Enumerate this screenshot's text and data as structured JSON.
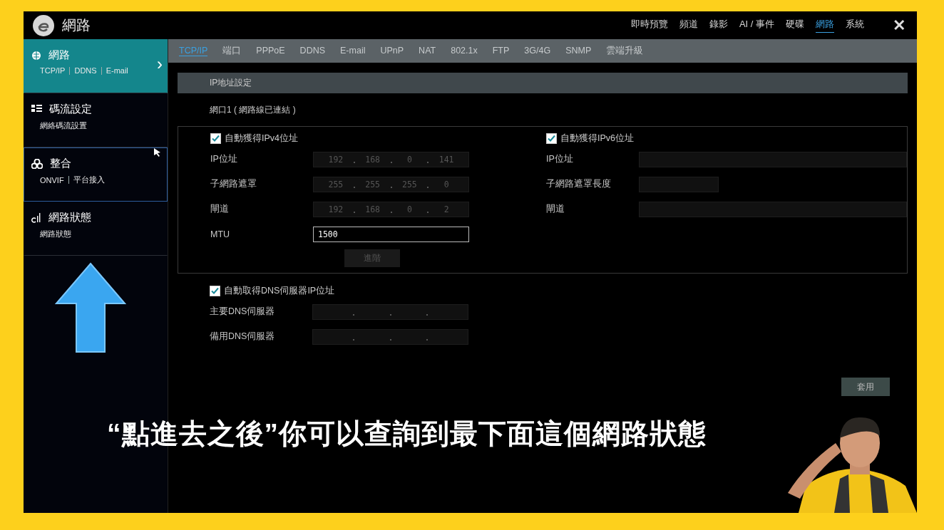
{
  "window": {
    "title": "網路"
  },
  "top_tabs": [
    {
      "label": "即時預覽",
      "selected": false
    },
    {
      "label": "頻道",
      "selected": false
    },
    {
      "label": "錄影",
      "selected": false
    },
    {
      "label": "AI / 事件",
      "selected": false
    },
    {
      "label": "硬碟",
      "selected": false
    },
    {
      "label": "網路",
      "selected": true
    },
    {
      "label": "系統",
      "selected": false
    }
  ],
  "close_button": "✕",
  "sidebar": {
    "items": [
      {
        "title": "網路",
        "subtitles": [
          "TCP/IP",
          "DDNS",
          "E-mail"
        ],
        "selected": true,
        "hovered": false,
        "chevron": "›"
      },
      {
        "title": "碼流設定",
        "subtitles": [
          "網絡碼流設置"
        ],
        "selected": false,
        "hovered": false
      },
      {
        "title": "整合",
        "subtitles": [
          "ONVIF",
          "平台接入"
        ],
        "selected": false,
        "hovered": true
      },
      {
        "title": "網路狀態",
        "subtitles": [
          "網路狀態"
        ],
        "selected": false,
        "hovered": false
      }
    ]
  },
  "sub_tabs": [
    {
      "label": "TCP/IP",
      "selected": true
    },
    {
      "label": "端口",
      "selected": false
    },
    {
      "label": "PPPoE",
      "selected": false
    },
    {
      "label": "DDNS",
      "selected": false
    },
    {
      "label": "E-mail",
      "selected": false
    },
    {
      "label": "UPnP",
      "selected": false
    },
    {
      "label": "NAT",
      "selected": false
    },
    {
      "label": "802.1x",
      "selected": false
    },
    {
      "label": "FTP",
      "selected": false
    },
    {
      "label": "3G/4G",
      "selected": false
    },
    {
      "label": "SNMP",
      "selected": false
    },
    {
      "label": "雲端升級",
      "selected": false
    }
  ],
  "section_title": "IP地址設定",
  "port_status": "網口1 ( 網路線已連結 )",
  "ipv4": {
    "auto": {
      "label": "自動獲得IPv4位址",
      "checked": true
    },
    "fields": [
      {
        "label": "IP位址",
        "kind": "ip",
        "octets": [
          "192",
          "168",
          "0",
          "141"
        ],
        "disabled": true
      },
      {
        "label": "子網路遮罩",
        "kind": "ip",
        "octets": [
          "255",
          "255",
          "255",
          "0"
        ],
        "disabled": true
      },
      {
        "label": "閘道",
        "kind": "ip",
        "octets": [
          "192",
          "168",
          "0",
          "2"
        ],
        "disabled": true
      },
      {
        "label": "MTU",
        "kind": "text",
        "value": "1500",
        "disabled": false
      }
    ],
    "advanced_button": {
      "label": "進階",
      "disabled": true
    }
  },
  "ipv6": {
    "auto": {
      "label": "自動獲得IPv6位址",
      "checked": true
    },
    "fields": [
      {
        "label": "IP位址",
        "kind": "text",
        "disabled": true
      },
      {
        "label": "子網路遮罩長度",
        "kind": "short",
        "disabled": true
      },
      {
        "label": "閘道",
        "kind": "text",
        "disabled": true
      }
    ]
  },
  "dns": {
    "auto": {
      "label": "自動取得DNS伺服器IP位址",
      "checked": true
    },
    "fields": [
      {
        "label": "主要DNS伺服器",
        "kind": "ip",
        "disabled": true
      },
      {
        "label": "備用DNS伺服器",
        "kind": "ip",
        "disabled": true
      }
    ]
  },
  "apply_button": "套用",
  "caption": "“點進去之後”你可以查詢到最下面這個網路狀態"
}
